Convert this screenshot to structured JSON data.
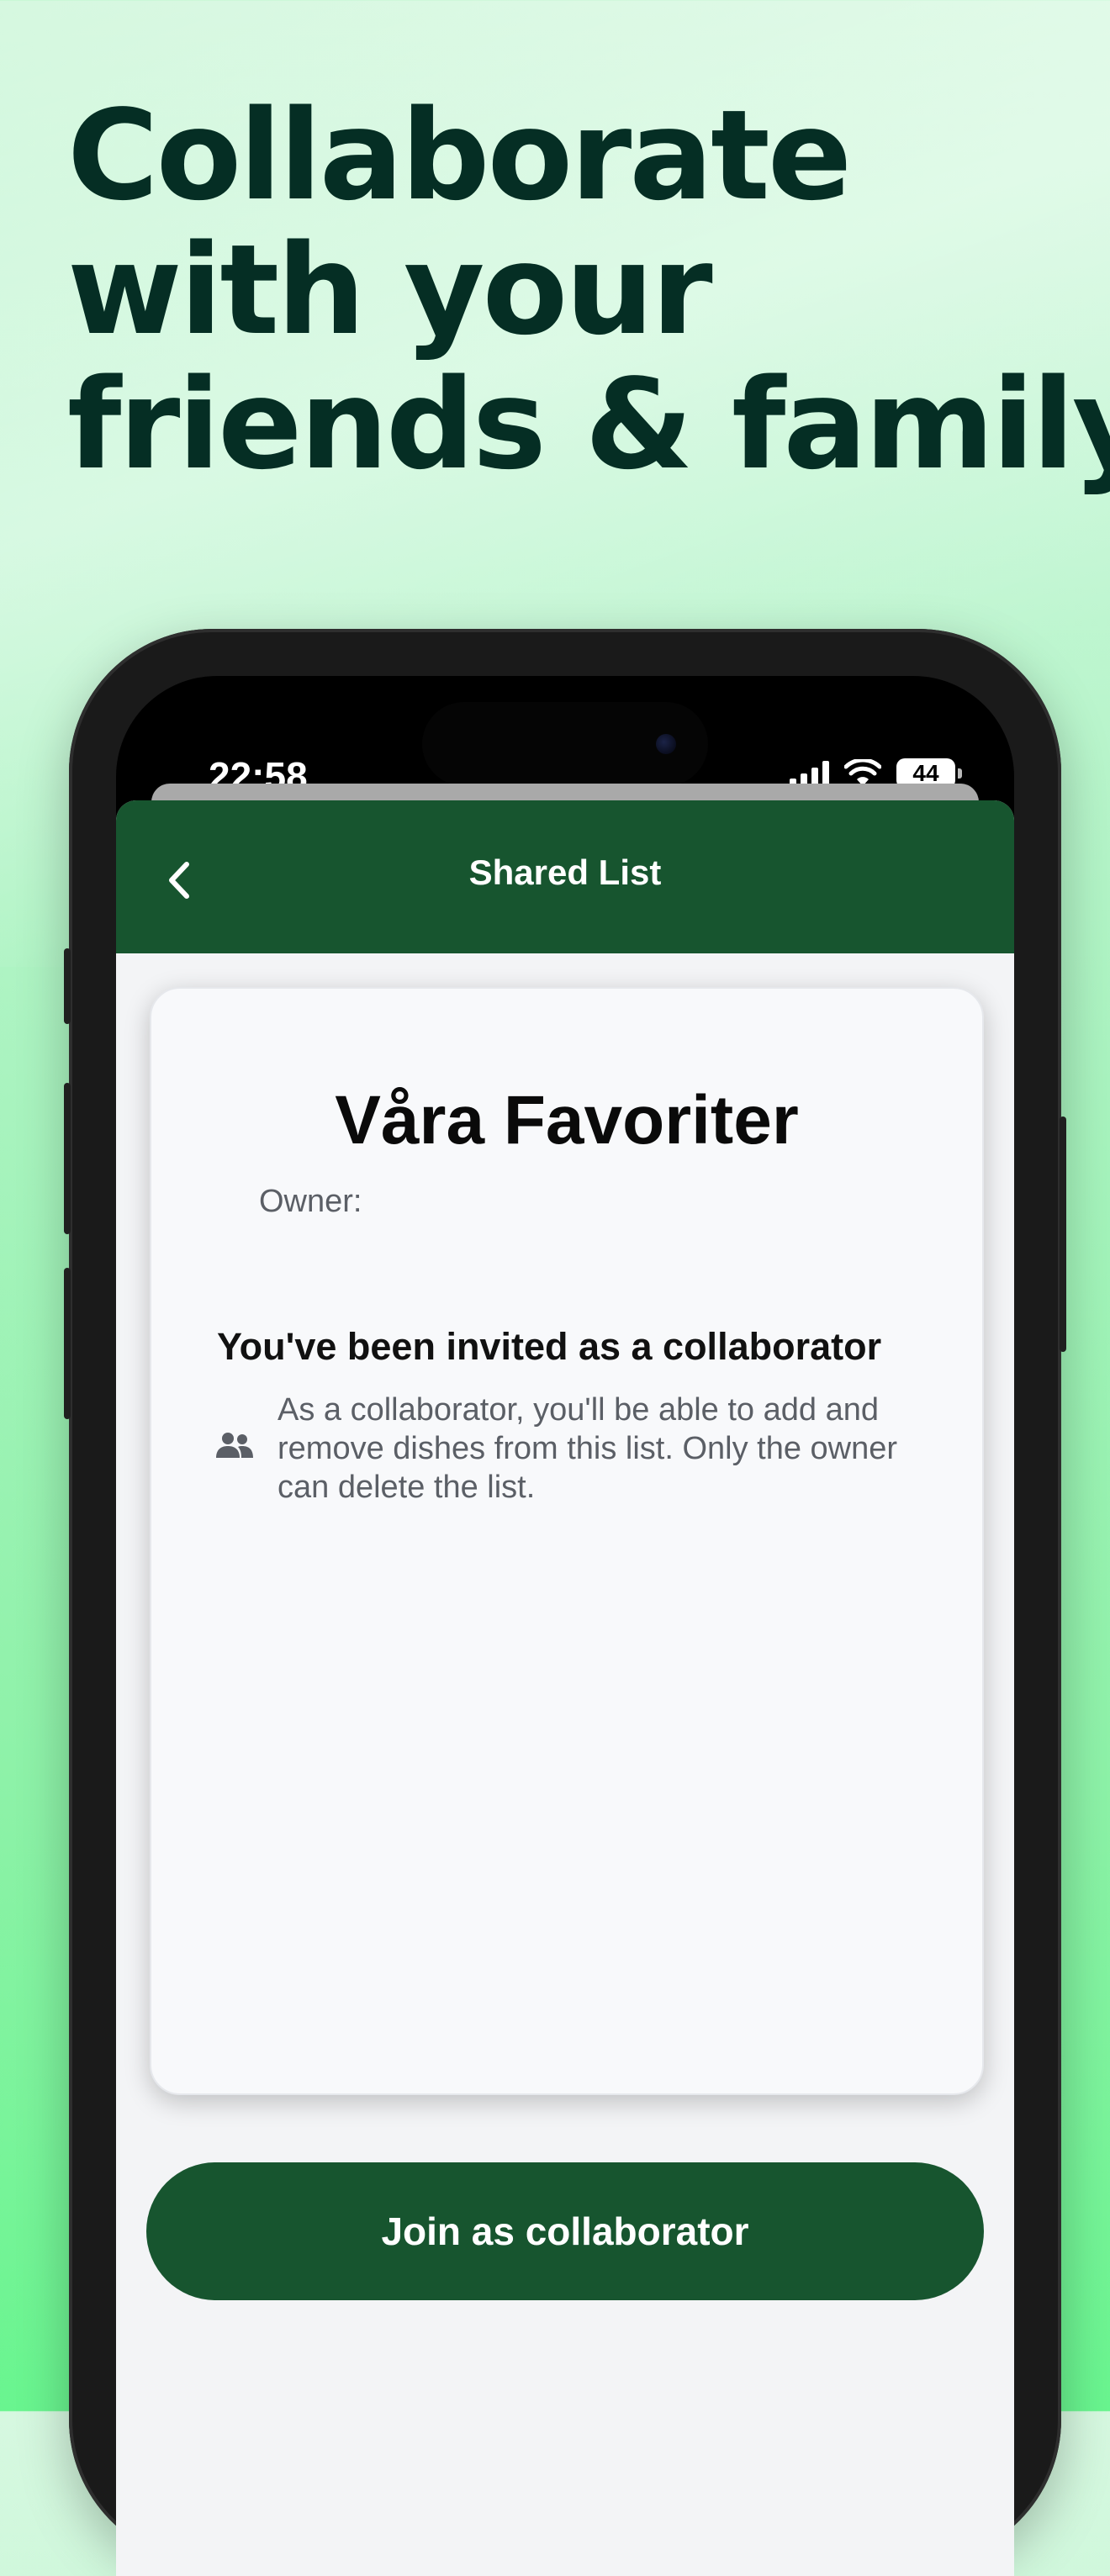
{
  "marketing": {
    "headline_lines": [
      "Collaborate",
      "with your",
      "friends & family"
    ]
  },
  "status_bar": {
    "time": "22:58",
    "battery": "44",
    "icons": [
      "cellular-signal-icon",
      "wifi-icon",
      "battery-icon"
    ]
  },
  "nav": {
    "title": "Shared List",
    "back_icon": "chevron-left-icon"
  },
  "list": {
    "name": "Våra Favoriter",
    "owner_label": "Owner:"
  },
  "invite": {
    "heading": "You've been invited as a collaborator",
    "icon": "people-icon",
    "description": "As a collaborator, you'll be able to add and remove dishes from this list. Only the owner can delete the list."
  },
  "actions": {
    "join_label": "Join as collaborator"
  },
  "colors": {
    "brand_green": "#17552f",
    "headline": "#052e24",
    "background_top": "#d6f8e0",
    "background_bottom": "#69f58f"
  }
}
